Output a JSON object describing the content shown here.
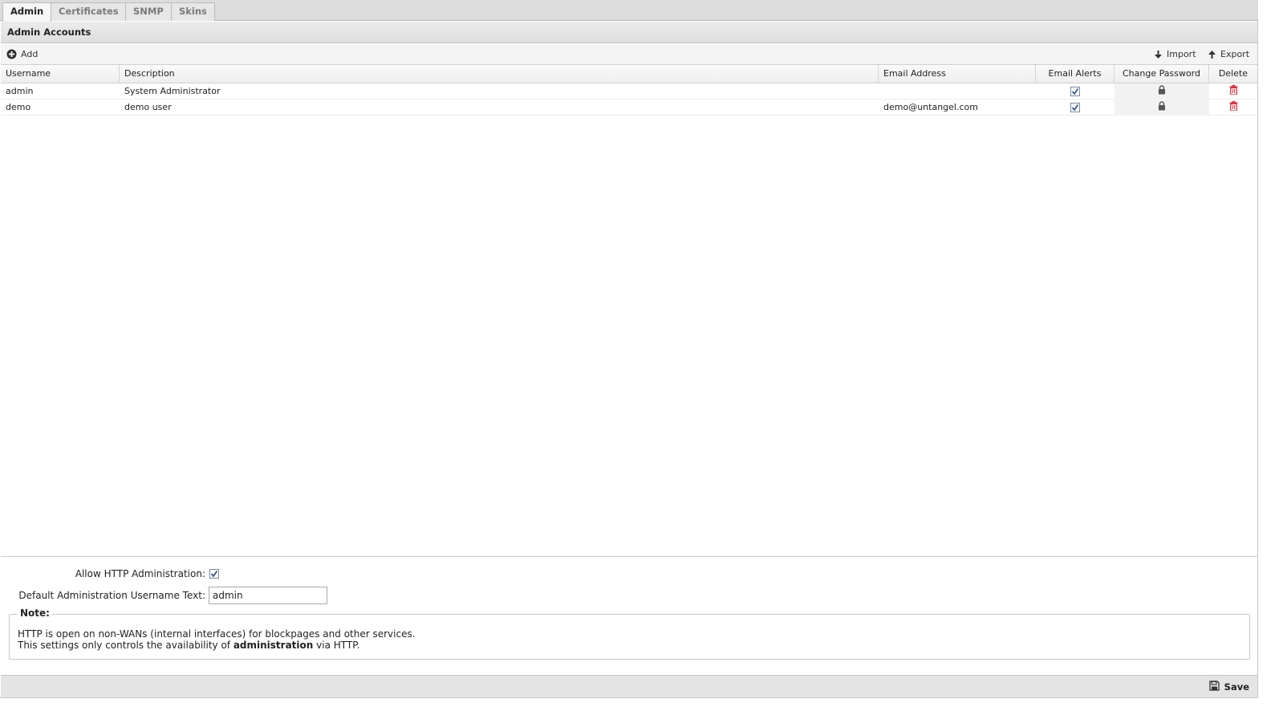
{
  "tabs": [
    {
      "label": "Admin",
      "active": true
    },
    {
      "label": "Certificates",
      "active": false
    },
    {
      "label": "SNMP",
      "active": false
    },
    {
      "label": "Skins",
      "active": false
    }
  ],
  "panel": {
    "title": "Admin Accounts"
  },
  "toolbar": {
    "add_label": "Add",
    "import_label": "Import",
    "export_label": "Export"
  },
  "grid": {
    "columns": [
      "Username",
      "Description",
      "Email Address",
      "Email Alerts",
      "Change Password",
      "Delete"
    ],
    "rows": [
      {
        "username": "admin",
        "description": "System Administrator",
        "email": "",
        "email_alerts": true
      },
      {
        "username": "demo",
        "description": "demo user",
        "email": "demo@untangel.com",
        "email_alerts": true
      }
    ]
  },
  "form": {
    "allow_http_label": "Allow HTTP Administration:",
    "allow_http_checked": true,
    "default_username_label": "Default Administration Username Text:",
    "default_username_value": "admin"
  },
  "note": {
    "legend": "Note:",
    "line1": "HTTP is open on non-WANs (internal interfaces) for blockpages and other services.",
    "line2_prefix": "This settings only controls the availability of ",
    "line2_bold": "administration",
    "line2_suffix": " via HTTP."
  },
  "footer": {
    "save_label": "Save"
  },
  "colors": {
    "delete_icon": "#e0303a",
    "check": "#2a4a8a"
  }
}
